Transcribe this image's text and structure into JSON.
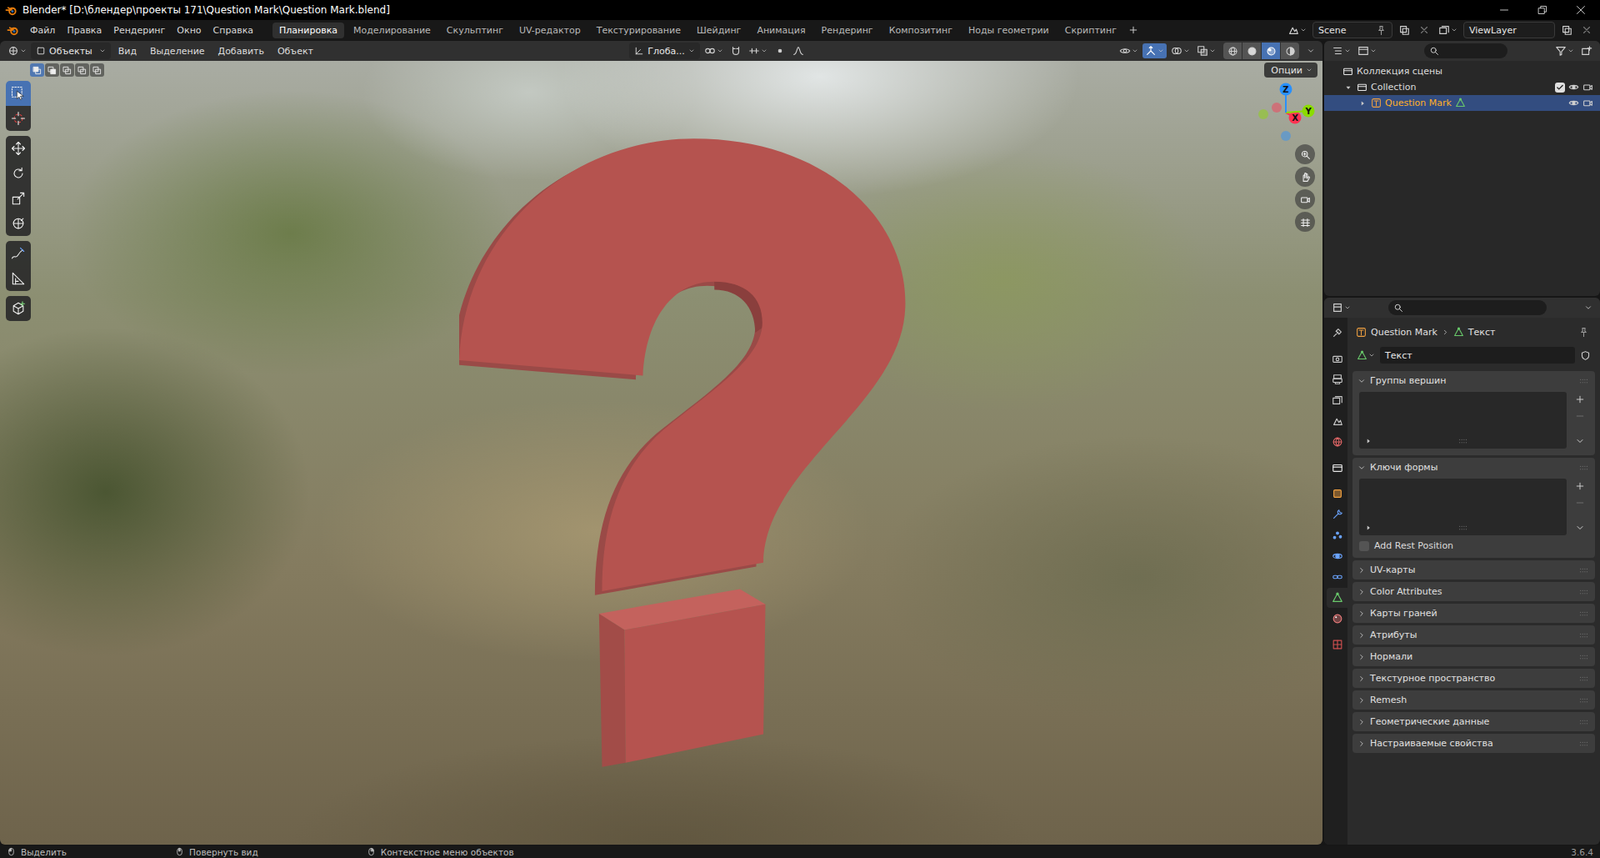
{
  "window": {
    "title": "Blender* [D:\\блендер\\проекты 171\\Question Mark\\Question Mark.blend]"
  },
  "menu": [
    "Файл",
    "Правка",
    "Рендеринг",
    "Окно",
    "Справка"
  ],
  "workspaces": [
    {
      "label": "Планировка",
      "selected": true
    },
    {
      "label": "Моделирование",
      "selected": false
    },
    {
      "label": "Скульптинг",
      "selected": false
    },
    {
      "label": "UV-редактор",
      "selected": false
    },
    {
      "label": "Текстурирование",
      "selected": false
    },
    {
      "label": "Шейдинг",
      "selected": false
    },
    {
      "label": "Анимация",
      "selected": false
    },
    {
      "label": "Рендеринг",
      "selected": false
    },
    {
      "label": "Композитинг",
      "selected": false
    },
    {
      "label": "Ноды геометрии",
      "selected": false
    },
    {
      "label": "Скриптинг",
      "selected": false
    }
  ],
  "scene": "Scene",
  "view_layer": "ViewLayer",
  "viewport": {
    "mode": "Объекты",
    "menus": [
      "Вид",
      "Выделение",
      "Добавить",
      "Объект"
    ],
    "orientation": "Глоба...",
    "options": "Опции",
    "select_modes": [
      {
        "selected": true
      },
      {
        "selected": false
      },
      {
        "selected": false
      },
      {
        "selected": false
      },
      {
        "selected": false
      }
    ],
    "toggles": [
      {
        "kind": "visibility",
        "on": false
      },
      {
        "kind": "gizmo",
        "on": true
      },
      {
        "kind": "overlay",
        "on": false
      },
      {
        "kind": "xray",
        "on": false
      }
    ],
    "shading": [
      {
        "kind": "wireframe",
        "selected": false
      },
      {
        "kind": "solid",
        "selected": false
      },
      {
        "kind": "material",
        "selected": true
      },
      {
        "kind": "rendered",
        "selected": false
      }
    ],
    "tool_groups": [
      [
        {
          "kind": "select",
          "selected": true
        },
        {
          "kind": "cursor",
          "selected": false
        }
      ],
      [
        {
          "kind": "move",
          "selected": false
        },
        {
          "kind": "rotate",
          "selected": false
        },
        {
          "kind": "scale",
          "selected": false
        },
        {
          "kind": "transform",
          "selected": false
        }
      ],
      [
        {
          "kind": "annotate",
          "selected": false
        },
        {
          "kind": "measure",
          "selected": false
        }
      ],
      [
        {
          "kind": "add-cube",
          "selected": false
        }
      ]
    ],
    "gizmo_axes": [
      {
        "label": "X",
        "color": "#ff3352"
      },
      {
        "label": "Y",
        "color": "#8bdc00"
      },
      {
        "label": "Z",
        "color": "#2890ff"
      }
    ]
  },
  "outliner": {
    "items": [
      {
        "label": "Коллекция сцены",
        "kind": "scene-collection",
        "selected": false,
        "children": [
          {
            "label": "Collection",
            "kind": "collection",
            "selected": false,
            "expanded": true,
            "checked": true,
            "children": [
              {
                "label": "Question Mark",
                "kind": "object",
                "selected": true,
                "active": true,
                "expanded": false
              }
            ]
          }
        ]
      }
    ]
  },
  "properties": {
    "tab_groups": [
      [
        {
          "kind": "tool",
          "selected": false
        }
      ],
      [
        {
          "kind": "render",
          "selected": false
        },
        {
          "kind": "output",
          "selected": false
        },
        {
          "kind": "view-layer",
          "selected": false
        },
        {
          "kind": "scene",
          "selected": false
        },
        {
          "kind": "world",
          "selected": false
        }
      ],
      [
        {
          "kind": "collection",
          "selected": false
        }
      ],
      [
        {
          "kind": "object",
          "selected": false
        },
        {
          "kind": "modifiers",
          "selected": false
        },
        {
          "kind": "particles",
          "selected": false
        },
        {
          "kind": "physics",
          "selected": false
        },
        {
          "kind": "constraints",
          "selected": false
        },
        {
          "kind": "data",
          "selected": true
        },
        {
          "kind": "material",
          "selected": false
        }
      ],
      [
        {
          "kind": "texture",
          "selected": false
        }
      ]
    ],
    "breadcrumb": [
      "Question Mark",
      "Текст"
    ],
    "datablock": "Текст",
    "panels": [
      {
        "label": "Группы вершин",
        "expanded": true
      },
      {
        "label": "Ключи формы",
        "expanded": true,
        "checkbox": {
          "label": "Add Rest Position",
          "checked": false
        }
      },
      {
        "label": "UV-карты",
        "expanded": false
      },
      {
        "label": "Color Attributes",
        "expanded": false
      },
      {
        "label": "Карты граней",
        "expanded": false
      },
      {
        "label": "Атрибуты",
        "expanded": false
      },
      {
        "label": "Нормали",
        "expanded": false
      },
      {
        "label": "Текстурное пространство",
        "expanded": false
      },
      {
        "label": "Remesh",
        "expanded": false
      },
      {
        "label": "Геометрические данные",
        "expanded": false
      },
      {
        "label": "Настраиваемые свойства",
        "expanded": false
      }
    ]
  },
  "status_bar": {
    "items": [
      "Выделить",
      "Повернуть вид",
      "Контекстное меню объектов"
    ],
    "version": "3.6.4"
  }
}
